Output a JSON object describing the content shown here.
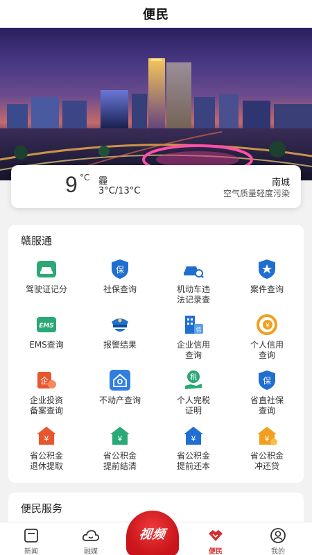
{
  "header": {
    "title": "便民"
  },
  "weather": {
    "temperature": "9",
    "unit": "°C",
    "condition": "霾",
    "range": "3°C/13°C",
    "district": "南城",
    "air_quality": "空气质量轻度污染"
  },
  "ganfutong": {
    "title": "赣服通",
    "items": [
      {
        "label": "驾驶证记分",
        "icon": "car-icon"
      },
      {
        "label": "社保查询",
        "icon": "shield-bao-icon"
      },
      {
        "label": "机动车违\n法记录查",
        "icon": "car-search-icon"
      },
      {
        "label": "案件查询",
        "icon": "police-badge-icon"
      },
      {
        "label": "EMS查询",
        "icon": "ems-icon"
      },
      {
        "label": "报警结果",
        "icon": "police-cap-icon"
      },
      {
        "label": "企业信用\n查询",
        "icon": "building-credit-icon"
      },
      {
        "label": "个人信用\n查询",
        "icon": "credit-coin-icon"
      },
      {
        "label": "企业投资\n备案查询",
        "icon": "enterprise-icon"
      },
      {
        "label": "不动产查询",
        "icon": "house-search-icon"
      },
      {
        "label": "个人完税\n证明",
        "icon": "tax-hand-icon"
      },
      {
        "label": "省直社保\n查询",
        "icon": "shield-bao-icon"
      },
      {
        "label": "省公积金\n退休提取",
        "icon": "house-yuan-icon"
      },
      {
        "label": "省公积金\n提前结清",
        "icon": "house-yuan-icon"
      },
      {
        "label": "省公积金\n提前还本",
        "icon": "house-yuan-icon"
      },
      {
        "label": "省公积金\n冲还贷",
        "icon": "house-yuan-icon"
      }
    ]
  },
  "services": {
    "title": "便民服务"
  },
  "tabbar": {
    "tabs": [
      {
        "label": "新闻",
        "icon": "news-icon"
      },
      {
        "label": "融媒",
        "icon": "cloud-icon"
      },
      {
        "label": "便民",
        "icon": "handshake-icon",
        "active": true
      },
      {
        "label": "我的",
        "icon": "user-icon"
      }
    ],
    "video_label": "视频"
  },
  "colors": {
    "green": "#2aa876",
    "blue": "#1f6fd1",
    "red": "#e8562e",
    "orange": "#f0a020",
    "accent": "#d32f2f"
  }
}
